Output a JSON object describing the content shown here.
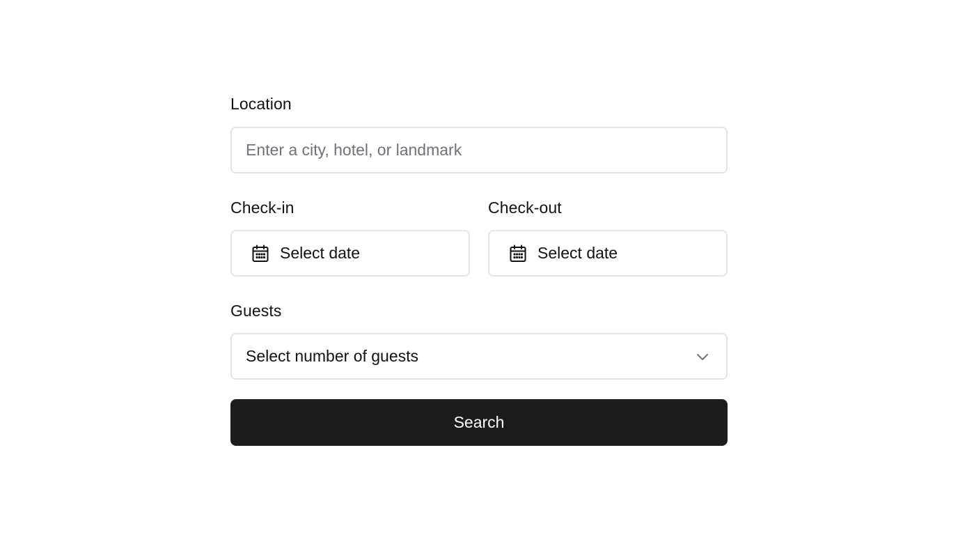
{
  "location": {
    "label": "Location",
    "placeholder": "Enter a city, hotel, or landmark",
    "value": ""
  },
  "checkin": {
    "label": "Check-in",
    "value": "Select date",
    "icon": "calendar-icon"
  },
  "checkout": {
    "label": "Check-out",
    "value": "Select date",
    "icon": "calendar-icon"
  },
  "guests": {
    "label": "Guests",
    "value": "Select number of guests",
    "icon": "chevron-down-icon"
  },
  "search": {
    "label": "Search"
  },
  "colors": {
    "button_bg": "#1c1c1e",
    "button_text": "#ffffff",
    "border": "#e4e4e7",
    "placeholder": "#71717a",
    "text": "#111111"
  }
}
